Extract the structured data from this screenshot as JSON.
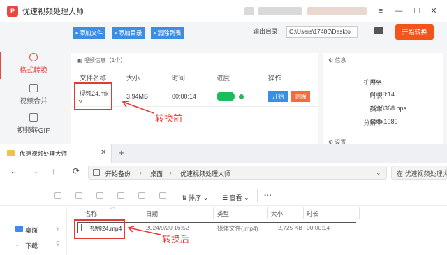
{
  "app": {
    "title": "优速视频处理大师",
    "logo_text": "P",
    "window_controls": [
      "≡",
      "—",
      "☐",
      "✕"
    ],
    "toolbar": {
      "add_file": "添加文件",
      "add_dir": "添加目录",
      "clear_list": "清除列表",
      "output_label": "输出目录:",
      "output_path": "C:\\Users\\17486\\Deskto",
      "start": "开始转换"
    },
    "sidebar": [
      {
        "label": "格式转换",
        "active": true
      },
      {
        "label": "视频合并",
        "active": false
      },
      {
        "label": "视频转GIF",
        "active": false
      }
    ],
    "section_title": "视频信息（1个）",
    "columns": [
      "文件名称",
      "大小",
      "时间",
      "进度",
      "操作"
    ],
    "row": {
      "name_line1": "视频24.mk",
      "name_line2": "v",
      "size": "3.94MB",
      "time": "00:00:14",
      "btn_start": "开始",
      "btn_delete": "删除"
    },
    "info": {
      "title": "信息",
      "items": [
        {
          "k": "扩展名:",
          "v": "mkv"
        },
        {
          "k": "时长:",
          "v": "00:00:14"
        },
        {
          "k": "码率:",
          "v": "2298368 bps"
        },
        {
          "k": "分辨率:",
          "v": "608x1080"
        }
      ],
      "settings": "设置"
    }
  },
  "annotations": {
    "before": "转换前",
    "after": "转换后"
  },
  "explorer": {
    "tab_title": "优速视频处理大师",
    "new_tab": "+",
    "nav": [
      "←",
      "→",
      "↑",
      "⟳"
    ],
    "breadcrumb": [
      "开始备份",
      "桌面",
      "优速视频处理大师"
    ],
    "search_placeholder": "在 优速视频处理大",
    "cmd": {
      "sort": "排序",
      "view": "查看",
      "more": "···"
    },
    "columns": [
      "名称",
      "日期",
      "类型",
      "大小",
      "时长"
    ],
    "nav_items": [
      {
        "label": "桌面"
      },
      {
        "label": "下载"
      }
    ],
    "file": {
      "name": "视频24.mp4",
      "date": "2024/9/20 16:52",
      "type": "媒体文件(.mp4)",
      "size": "2,725 KB",
      "duration": "00:00:14"
    }
  },
  "colors": {
    "accent_blue": "#3a8ee6",
    "start_orange": "#f2541b",
    "delete_red": "#f56c3b",
    "progress_green": "#1fba5a",
    "annotation_red": "#e53935"
  }
}
